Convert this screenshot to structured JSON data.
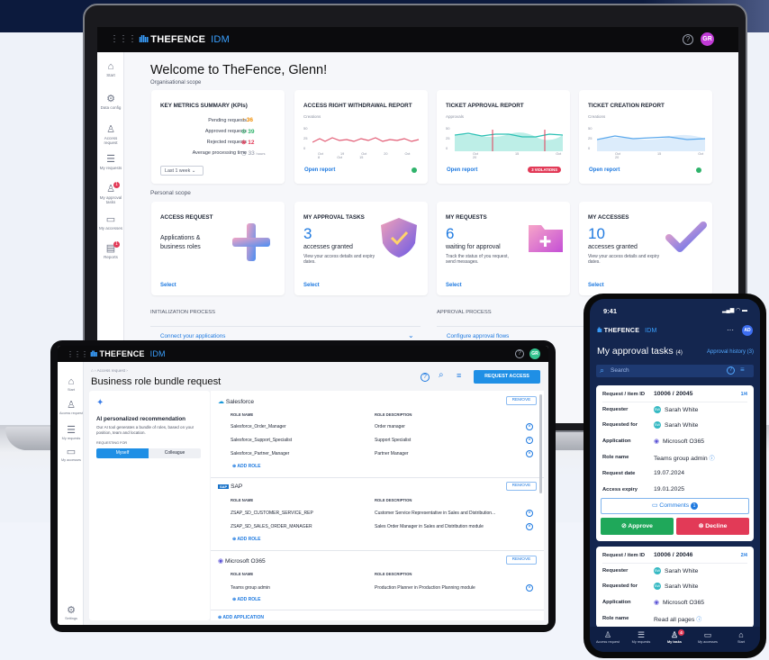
{
  "laptop": {
    "brand": "THEFENCE",
    "brand_suffix": "IDM",
    "user_initials": "GR",
    "sidebar": [
      {
        "label": "Start",
        "icon": "home-icon",
        "badge": ""
      },
      {
        "label": "Data config",
        "icon": "data-config-icon",
        "badge": ""
      },
      {
        "label": "Access request",
        "icon": "person-add-icon",
        "badge": ""
      },
      {
        "label": "My requests",
        "icon": "list-icon",
        "badge": ""
      },
      {
        "label": "My approval tasks",
        "icon": "approval-icon",
        "badge": "1"
      },
      {
        "label": "My accesses",
        "icon": "folder-icon",
        "badge": ""
      },
      {
        "label": "Reports",
        "icon": "report-icon",
        "badge": "1"
      }
    ],
    "welcome": "Welcome to TheFence, Glenn!",
    "org_scope": "Organisational scope",
    "personal_scope": "Personal scope",
    "kpi": {
      "title": "KEY METRICS SUMMARY (KPIs)",
      "rows": [
        {
          "label": "Pending requests",
          "value": "36",
          "color": "#f08c00"
        },
        {
          "label": "Approved requests",
          "value": "39",
          "color": "#2fb36b"
        },
        {
          "label": "Rejected requests",
          "value": "12",
          "color": "#e23a57"
        },
        {
          "label": "Average processing time",
          "value": "33",
          "unit": "hours",
          "color": "#8a90a0"
        }
      ],
      "period": "Last 1 week"
    },
    "reports": [
      {
        "title": "ACCESS RIGHT WITHDRAWAL REPORT",
        "axis": "Creations",
        "ticks": [
          "50",
          "25",
          "0"
        ],
        "dates": [
          "Oct 19",
          "Oct 20",
          "Oct 8",
          "Oct 15"
        ],
        "link": "Open report",
        "status": "ok"
      },
      {
        "title": "TICKET APPROVAL REPORT",
        "axis": "Approvals",
        "ticks": [
          "50",
          "25",
          "0"
        ],
        "dates": [
          "Oct 15",
          "Oct 20"
        ],
        "link": "Open report",
        "status": "3 VIOLATIONS"
      },
      {
        "title": "TICKET CREATION REPORT",
        "axis": "Creations",
        "ticks": [
          "50",
          "25",
          "0"
        ],
        "dates": [
          "Oct 15",
          "Oct 20"
        ],
        "link": "Open report",
        "status": "ok"
      }
    ],
    "personal": [
      {
        "title": "ACCESS REQUEST",
        "big": "",
        "text": "Applications & business roles",
        "desc": "",
        "link": "Select"
      },
      {
        "title": "MY APPROVAL TASKS",
        "big": "3",
        "text": "accesses granted",
        "desc": "View your access details and expiry dates.",
        "link": "Select"
      },
      {
        "title": "MY REQUESTS",
        "big": "6",
        "text": "waiting for approval",
        "desc": "Track the status of you request, send messages.",
        "link": "Select"
      },
      {
        "title": "MY ACCESSES",
        "big": "10",
        "text": "accesses granted",
        "desc": "View your access details and expiry dates.",
        "link": "Select"
      }
    ],
    "init_title": "INITIALIZATION PROCESS",
    "init_link": "Connect your applications",
    "approval_title": "APPROVAL PROCESS",
    "approval_link": "Configure approval flows"
  },
  "tablet": {
    "brand": "THEFENCE",
    "brand_suffix": "IDM",
    "user_initials": "GR",
    "sidebar": [
      {
        "label": "Start",
        "icon": "home-icon"
      },
      {
        "label": "Access request",
        "icon": "person-add-icon"
      },
      {
        "label": "My requests",
        "icon": "list-icon"
      },
      {
        "label": "My accesses",
        "icon": "folder-icon"
      }
    ],
    "settings": "Settings",
    "breadcrumb": "Access request",
    "title": "Business role bundle request",
    "request_btn": "REQUEST ACCESS",
    "ai": {
      "title": "AI personalized recommendation",
      "desc": "Our AI tool generates a bundle of roles, based on your position, team and location.",
      "req_for": "REQUESTING FOR",
      "opt1": "Myself",
      "opt2": "Colleague"
    },
    "col_role": "ROLE NAME",
    "col_desc": "ROLE DESCRIPTION",
    "remove": "REMOVE",
    "add_role": "ADD ROLE",
    "add_app": "ADD APPLICATION",
    "apps": [
      {
        "name": "Salesforce",
        "logo": "salesforce-logo",
        "roles": [
          {
            "name": "Salesforce_Order_Manager",
            "desc": "Order manager"
          },
          {
            "name": "Salesforce_Support_Specialist",
            "desc": "Support Specialist"
          },
          {
            "name": "Salesforce_Partner_Manager",
            "desc": "Partner Manager"
          }
        ]
      },
      {
        "name": "SAP",
        "logo": "sap-logo",
        "roles": [
          {
            "name": "ZSAP_SD_CUSTOMER_SERVICE_REP",
            "desc": "Customer Service Representative in Sales and Distribution..."
          },
          {
            "name": "ZSAP_SD_SALES_ORDER_MANAGER",
            "desc": "Sales Order Manager in Sales and Distribution module"
          }
        ]
      },
      {
        "name": "Microsoft O365",
        "logo": "o365-logo",
        "roles": [
          {
            "name": "Teams group admin",
            "desc": "Production Planner in Production Planning module"
          }
        ]
      }
    ]
  },
  "phone": {
    "time": "9:41",
    "brand": "THEFENCE",
    "brand_suffix": "IDM",
    "user_initials": "AD",
    "title": "My approval tasks",
    "count": "(4)",
    "history": "Approval history",
    "history_count": "(3)",
    "search": "Search",
    "labels": {
      "id": "Request / item ID",
      "requester": "Requester",
      "requested_for": "Requested for",
      "application": "Application",
      "role": "Role name",
      "date": "Request date",
      "expiry": "Access expiry"
    },
    "tasks": [
      {
        "id": "10006 / 20045",
        "page": "1/4",
        "requester": "Sarah White",
        "requested_for": "Sarah White",
        "application": "Microsoft O365",
        "role": "Teams group admin",
        "date": "19.07.2024",
        "expiry": "19.01.2025",
        "comments": "Comments",
        "comment_count": "1",
        "approve": "Approve",
        "decline": "Decline"
      },
      {
        "id": "10006 / 20046",
        "page": "2/4",
        "requester": "Sarah White",
        "requested_for": "Sarah White",
        "application": "Microsoft O365",
        "role": "Read all pages"
      }
    ],
    "initials": "SW",
    "nav": [
      {
        "label": "Access request",
        "icon": "person-add-icon"
      },
      {
        "label": "My requests",
        "icon": "list-icon"
      },
      {
        "label": "My tasks",
        "icon": "approval-icon",
        "badge": "4"
      },
      {
        "label": "My accesses",
        "icon": "folder-icon"
      },
      {
        "label": "Start",
        "icon": "home-icon"
      }
    ]
  },
  "colors": {
    "accent": "#1f7ae0",
    "danger": "#e23a57",
    "success": "#2fb36b",
    "navy": "#14264f"
  }
}
